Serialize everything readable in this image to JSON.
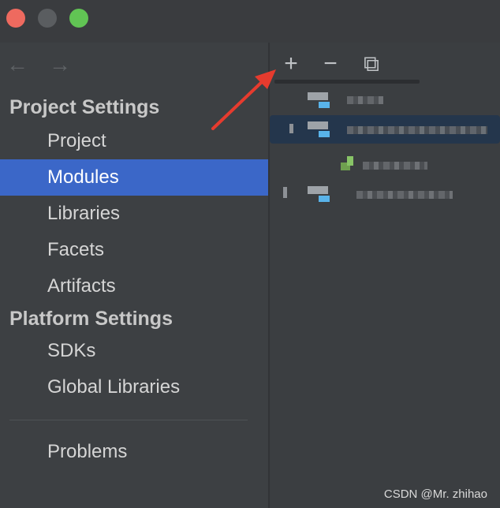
{
  "window": {
    "controls": [
      "close",
      "minimize",
      "maximize"
    ]
  },
  "navigation": {
    "back_icon": "←",
    "forward_icon": "→"
  },
  "sidebar": {
    "project_settings_heading": "Project Settings",
    "project_items": [
      {
        "label": "Project"
      },
      {
        "label": "Modules",
        "selected": true
      },
      {
        "label": "Libraries"
      },
      {
        "label": "Facets"
      },
      {
        "label": "Artifacts"
      }
    ],
    "platform_settings_heading": "Platform Settings",
    "platform_items": [
      {
        "label": "SDKs"
      },
      {
        "label": "Global Libraries"
      }
    ],
    "problems_label": "Problems"
  },
  "toolbar": {
    "add_icon": "+",
    "remove_icon": "−",
    "copy_icon": "⧉"
  },
  "colors": {
    "selected_nav": "#3b67c8",
    "annotation_arrow": "#e63b2e",
    "module_icon_blue": "#59b3e9"
  },
  "watermark": "CSDN @Mr. zhihao"
}
